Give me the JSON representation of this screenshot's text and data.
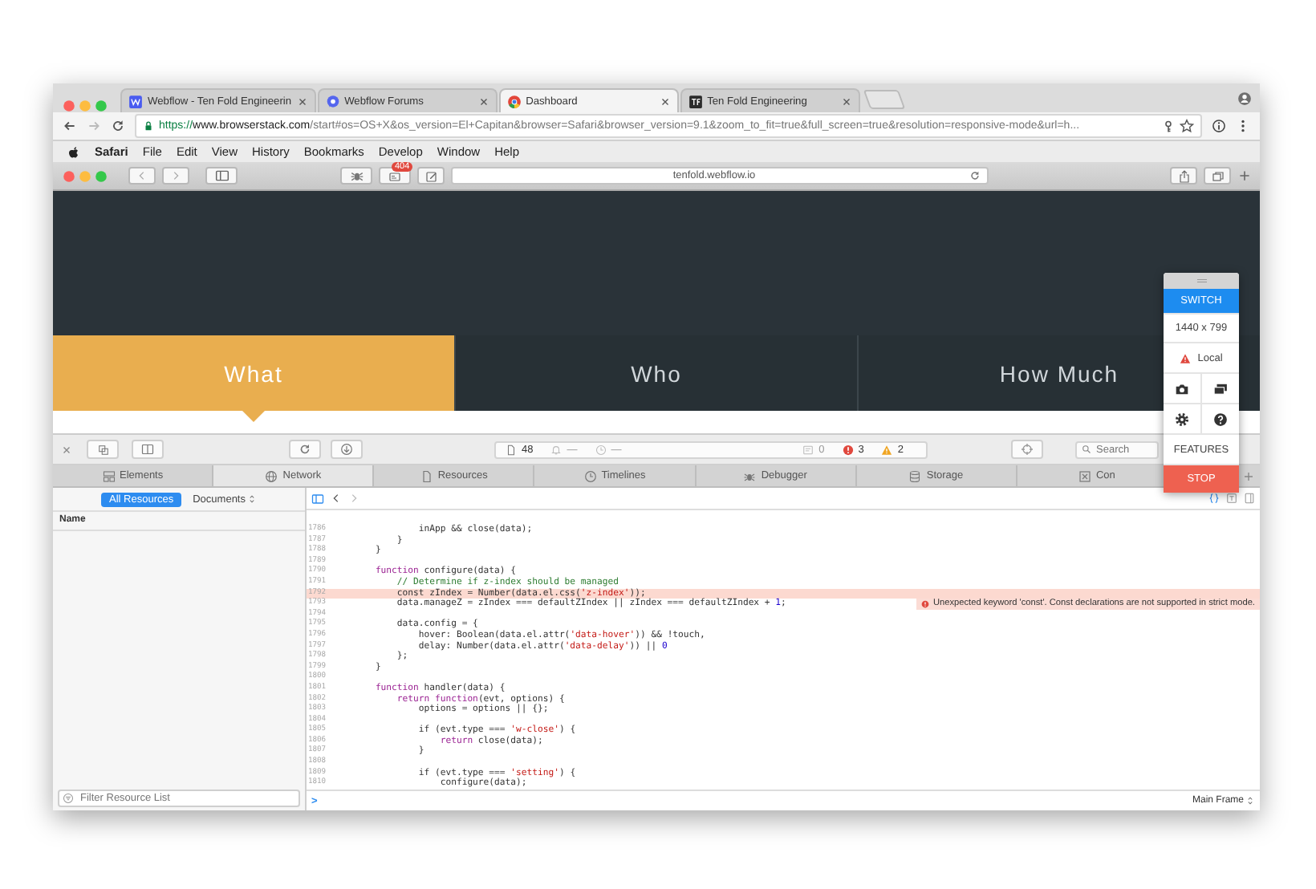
{
  "browser_tabs": [
    {
      "title": "Webflow - Ten Fold Engineerin",
      "kind": "square",
      "selected": false
    },
    {
      "title": "Webflow Forums",
      "kind": "bubble",
      "selected": false
    },
    {
      "title": "Dashboard",
      "kind": "ring",
      "selected": true
    },
    {
      "title": "Ten Fold Engineering",
      "kind": "dark",
      "selected": false
    }
  ],
  "address": {
    "scheme": "https://",
    "host": "www.browserstack.com",
    "path": "/start#os=OS+X&os_version=El+Capitan&browser=Safari&browser_version=9.1&zoom_to_fit=true&full_screen=true&resolution=responsive-mode&url=h..."
  },
  "menu_bar": {
    "app": "Safari",
    "items": [
      "File",
      "Edit",
      "View",
      "History",
      "Bookmarks",
      "Develop",
      "Window",
      "Help"
    ]
  },
  "safari": {
    "badge": "404",
    "address": "tenfold.webflow.io"
  },
  "site_nav": [
    {
      "label": "What",
      "selected": true
    },
    {
      "label": "Who",
      "selected": false
    },
    {
      "label": "How Much",
      "selected": false
    }
  ],
  "inspector": {
    "toolbar": {
      "resources": "48",
      "requests": "—",
      "time": "—",
      "logs": "0",
      "errors": "3",
      "warnings": "2",
      "search_placeholder": "Search"
    },
    "tabs": [
      {
        "label": "Elements",
        "kind": "elements",
        "selected": false
      },
      {
        "label": "Network",
        "kind": "network",
        "selected": true
      },
      {
        "label": "Resources",
        "kind": "resources",
        "selected": false
      },
      {
        "label": "Timelines",
        "kind": "timelines",
        "selected": false
      },
      {
        "label": "Debugger",
        "kind": "debugger",
        "selected": false
      },
      {
        "label": "Storage",
        "kind": "storage",
        "selected": false
      },
      {
        "label": "Con",
        "kind": "console",
        "selected": false
      }
    ],
    "sidebar": {
      "filters": [
        {
          "label": "All Resources",
          "selected": true
        }
      ],
      "type_filter": "Documents",
      "column": "Name",
      "filter_placeholder": "Filter Resource List"
    },
    "code": {
      "lines": [
        {
          "number": "1786",
          "error": false,
          "segments": [
            {
              "kind": "plain",
              "text": "                inApp && close(data);"
            }
          ]
        },
        {
          "number": "1787",
          "error": false,
          "segments": [
            {
              "kind": "plain",
              "text": "            }"
            }
          ]
        },
        {
          "number": "1788",
          "error": false,
          "segments": [
            {
              "kind": "plain",
              "text": "        }"
            }
          ]
        },
        {
          "number": "1789",
          "error": false
        },
        {
          "number": "1790",
          "error": false,
          "segments": [
            {
              "kind": "keyword",
              "text": "        function"
            },
            {
              "kind": "plain",
              "text": " configure(data) {"
            }
          ]
        },
        {
          "number": "1791",
          "error": false,
          "segments": [
            {
              "kind": "comment",
              "text": "            // Determine if z-index should be managed"
            }
          ]
        },
        {
          "number": "1792",
          "error": true,
          "segments": [
            {
              "kind": "plain",
              "text": "            const zIndex = Number(data.el.css("
            },
            {
              "kind": "string",
              "text": "'z-index'"
            },
            {
              "kind": "plain",
              "text": "));"
            }
          ]
        },
        {
          "number": "1793",
          "error": false,
          "segments": [
            {
              "kind": "plain",
              "text": "            data.manageZ = zIndex === defaultZIndex || zIndex === defaultZIndex + "
            },
            {
              "kind": "number",
              "text": "1"
            },
            {
              "kind": "plain",
              "text": ";"
            }
          ],
          "message": "Unexpected keyword 'const'. Const declarations are not supported in strict mode."
        },
        {
          "number": "1794",
          "error": false
        },
        {
          "number": "1795",
          "error": false,
          "segments": [
            {
              "kind": "plain",
              "text": "            data.config = {"
            }
          ]
        },
        {
          "number": "1796",
          "error": false,
          "segments": [
            {
              "kind": "plain",
              "text": "                hover: Boolean(data.el.attr("
            },
            {
              "kind": "string",
              "text": "'data-hover'"
            },
            {
              "kind": "plain",
              "text": ")) && !touch,"
            }
          ]
        },
        {
          "number": "1797",
          "error": false,
          "segments": [
            {
              "kind": "plain",
              "text": "                delay: Number(data.el.attr("
            },
            {
              "kind": "string",
              "text": "'data-delay'"
            },
            {
              "kind": "plain",
              "text": ")) || "
            },
            {
              "kind": "number",
              "text": "0"
            }
          ]
        },
        {
          "number": "1798",
          "error": false,
          "segments": [
            {
              "kind": "plain",
              "text": "            };"
            }
          ]
        },
        {
          "number": "1799",
          "error": false,
          "segments": [
            {
              "kind": "plain",
              "text": "        }"
            }
          ]
        },
        {
          "number": "1800",
          "error": false
        },
        {
          "number": "1801",
          "error": false,
          "segments": [
            {
              "kind": "keyword",
              "text": "        function"
            },
            {
              "kind": "plain",
              "text": " handler(data) {"
            }
          ]
        },
        {
          "number": "1802",
          "error": false,
          "segments": [
            {
              "kind": "keyword",
              "text": "            return function"
            },
            {
              "kind": "plain",
              "text": "(evt, options) {"
            }
          ]
        },
        {
          "number": "1803",
          "error": false,
          "segments": [
            {
              "kind": "plain",
              "text": "                options = options || {};"
            }
          ]
        },
        {
          "number": "1804",
          "error": false
        },
        {
          "number": "1805",
          "error": false,
          "segments": [
            {
              "kind": "plain",
              "text": "                if (evt.type === "
            },
            {
              "kind": "string",
              "text": "'w-close'"
            },
            {
              "kind": "plain",
              "text": ") {"
            }
          ]
        },
        {
          "number": "1806",
          "error": false,
          "segments": [
            {
              "kind": "keyword",
              "text": "                    return"
            },
            {
              "kind": "plain",
              "text": " close(data);"
            }
          ]
        },
        {
          "number": "1807",
          "error": false,
          "segments": [
            {
              "kind": "plain",
              "text": "                }"
            }
          ]
        },
        {
          "number": "1808",
          "error": false
        },
        {
          "number": "1809",
          "error": false,
          "segments": [
            {
              "kind": "plain",
              "text": "                if (evt.type === "
            },
            {
              "kind": "string",
              "text": "'setting'"
            },
            {
              "kind": "plain",
              "text": ") {"
            }
          ]
        },
        {
          "number": "1810",
          "error": false,
          "segments": [
            {
              "kind": "plain",
              "text": "                    configure(data);"
            }
          ]
        }
      ]
    },
    "prompt": ">",
    "frame": "Main Frame"
  },
  "panel": {
    "switch": "SWITCH",
    "resolution": "1440 x 799",
    "network": "Local",
    "features": "FEATURES",
    "stop": "STOP"
  }
}
